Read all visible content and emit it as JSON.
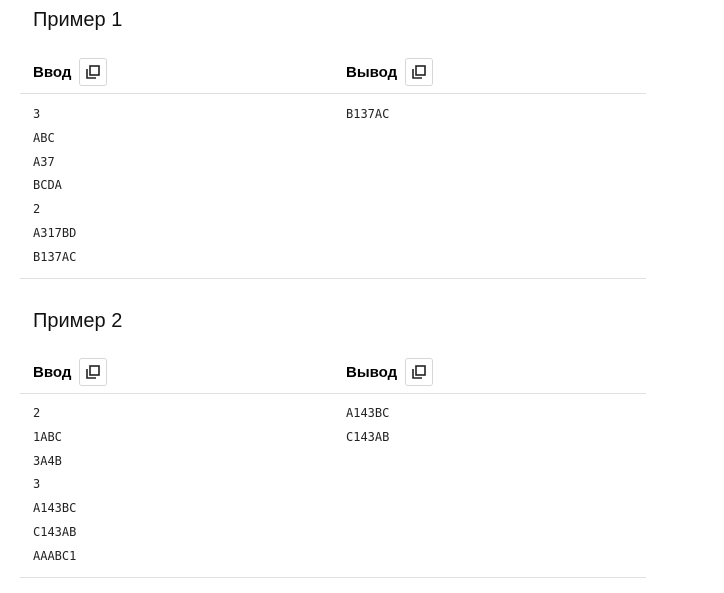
{
  "examples": [
    {
      "title": "Пример 1",
      "input_label": "Ввод",
      "output_label": "Вывод",
      "input_lines": [
        "3",
        "ABC",
        "A37",
        "BCDA",
        "2",
        "A317BD",
        "B137AC"
      ],
      "output_lines": [
        "B137AC"
      ]
    },
    {
      "title": "Пример 2",
      "input_label": "Ввод",
      "output_label": "Вывод",
      "input_lines": [
        "2",
        "1ABC",
        "3A4B",
        "3",
        "A143BC",
        "C143AB",
        "AAABC1"
      ],
      "output_lines": [
        "A143BC",
        "C143AB"
      ]
    }
  ],
  "icons": {
    "copy": "copy-icon"
  }
}
